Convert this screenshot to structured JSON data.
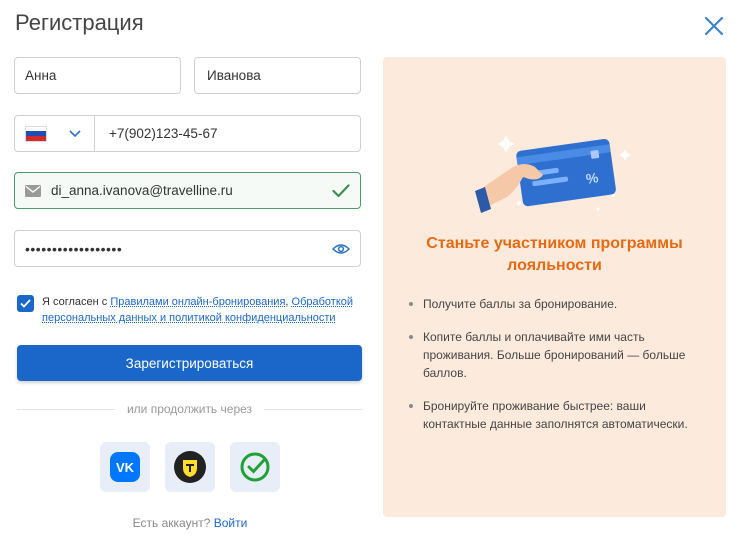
{
  "dialog": {
    "title": "Регистрация"
  },
  "form": {
    "first_name": "Анна",
    "last_name": "Иванова",
    "phone": "+7(902)123-45-67",
    "email": "di_anna.ivanova@travelline.ru",
    "password": "••••••••••••••••••"
  },
  "consent": {
    "prefix": "Я согласен с ",
    "link1": "Правилами онлайн-бронирования",
    "sep": ", ",
    "link2": "Обработкой персональных данных и политикой конфиденциальности",
    "checked": true
  },
  "register_button": "Зарегистрироваться",
  "divider_text": "или продолжить через",
  "login": {
    "prompt": "Есть аккаунт?",
    "link": "Войти"
  },
  "promo": {
    "title": "Станьте участником программы лояльности",
    "bullets": [
      "Получите баллы за бронирование.",
      "Копите баллы и оплачивайте ими часть проживания. Больше бронирований — больше баллов.",
      "Бронируйте проживание быстрее: ваши контактные данные заполнятся автоматически."
    ]
  },
  "colors": {
    "primary": "#1b67c9",
    "accent": "#e56a12",
    "promo_bg": "#fcebdd",
    "valid": "#3f8f52"
  },
  "icons": [
    "close-icon",
    "russia-flag-icon",
    "chevron-down-icon",
    "mail-icon",
    "check-icon",
    "eye-icon",
    "checkbox-check-icon",
    "vk-icon",
    "tinkoff-icon",
    "sber-icon",
    "loyalty-card-illustration"
  ]
}
